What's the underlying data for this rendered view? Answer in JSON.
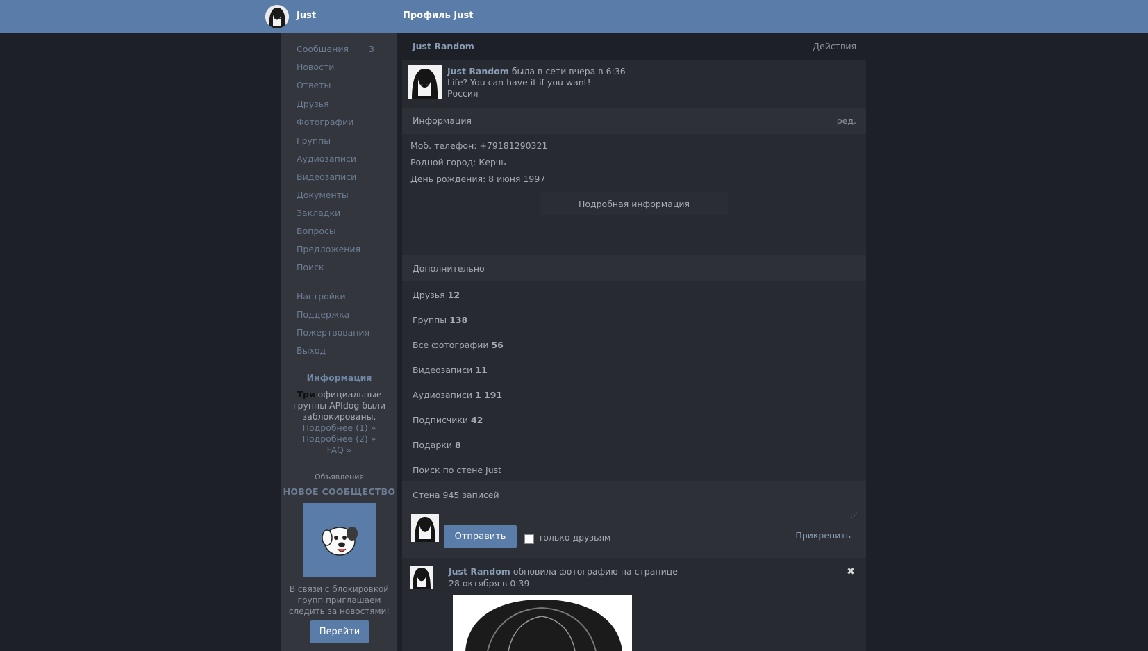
{
  "topbar": {
    "user_name": "Just",
    "page_title": "Профиль Just"
  },
  "sidebar": {
    "items": [
      {
        "label": "Сообщения",
        "count": "3"
      },
      {
        "label": "Новости"
      },
      {
        "label": "Ответы"
      },
      {
        "label": "Друзья"
      },
      {
        "label": "Фотографии"
      },
      {
        "label": "Группы"
      },
      {
        "label": "Аудиозаписи"
      },
      {
        "label": "Видеозаписи"
      },
      {
        "label": "Документы"
      },
      {
        "label": "Закладки"
      },
      {
        "label": "Вопросы"
      },
      {
        "label": "Предложения"
      },
      {
        "label": "Поиск"
      },
      {
        "label": "Настройки"
      },
      {
        "label": "Поддержка"
      },
      {
        "label": "Пожертвования"
      },
      {
        "label": "Выход"
      }
    ],
    "info": {
      "title": "Информация",
      "text_bold": "Три",
      "text_rest": " официальные группы APIdog были заблокированы.",
      "link1": "Подробнее (1) »",
      "link2": "Подробнее (2) »",
      "link3": "FAQ »"
    },
    "ads": {
      "label": "Объявления",
      "title": "НОВОЕ СООБЩЕСТВО",
      "text": "В связи с блокировкой групп приглашаем следить за новостями!",
      "button": "Перейти"
    }
  },
  "profile": {
    "header_name": "Just Random",
    "actions": "Действия",
    "name": "Just Random",
    "online_status": " была в сети вчера в 6:36",
    "status_text": "Life? You can have it if you want!",
    "country": "Россия"
  },
  "information": {
    "title": "Информация",
    "edit": "ред.",
    "phone_label": "Моб. телефон:",
    "phone_value": "+79181290321",
    "city_label": "Родной город:",
    "city_value": "Керчь",
    "birthday_label": "День рождения:",
    "birthday_value": "8 июня 1997",
    "more_button": "Подробная информация"
  },
  "additional": {
    "title": "Дополнительно",
    "stats": [
      {
        "label": "Друзья",
        "value": "12"
      },
      {
        "label": "Группы",
        "value": "138"
      },
      {
        "label": "Все фотографии",
        "value": "56"
      },
      {
        "label": "Видеозаписи",
        "value": "11"
      },
      {
        "label": "Аудиозаписи",
        "value": "1 191"
      },
      {
        "label": "Подписчики",
        "value": "42"
      },
      {
        "label": "Подарки",
        "value": "8"
      }
    ],
    "wall_search": "Поиск по стене Just"
  },
  "wall": {
    "title": "Стена 945 записей",
    "send_button": "Отправить",
    "friends_only_label": "только друзьям",
    "attach": "Прикрепить"
  },
  "post": {
    "author": "Just Random",
    "action": " обновила фотографию на странице",
    "date": "28 октября в 0:39"
  }
}
